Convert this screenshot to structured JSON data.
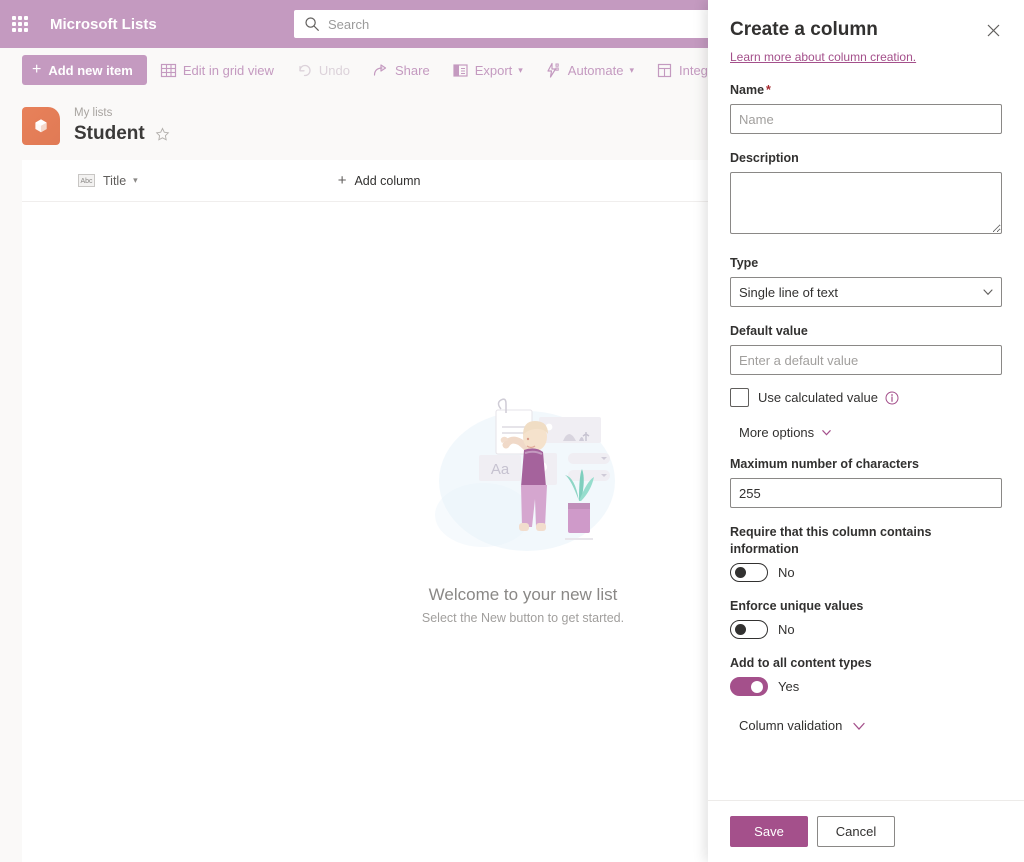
{
  "suite": {
    "waffle_icon": "waffle-grid-icon",
    "app_title": "Microsoft Lists",
    "search": {
      "icon": "search-icon",
      "placeholder": "Search",
      "value": ""
    },
    "bar_color": "#c49ac0"
  },
  "command_bar": {
    "primary": {
      "label": "Add new item",
      "icon": "plus-icon"
    },
    "items": [
      {
        "label": "Edit in grid view",
        "icon": "grid-icon",
        "disabled": false,
        "chevron": false
      },
      {
        "label": "Undo",
        "icon": "undo-icon",
        "disabled": true,
        "chevron": false
      },
      {
        "label": "Share",
        "icon": "share-icon",
        "disabled": false,
        "chevron": false
      },
      {
        "label": "Export",
        "icon": "export-icon",
        "disabled": false,
        "chevron": true
      },
      {
        "label": "Automate",
        "icon": "automate-icon",
        "disabled": false,
        "chevron": true
      },
      {
        "label": "Integ",
        "icon": "integrate-icon",
        "disabled": false,
        "chevron": false
      }
    ]
  },
  "list_header": {
    "logo_icon": "list-cube-icon",
    "logo_color": "#e8815a",
    "breadcrumb": "My lists",
    "title": "Student",
    "favorite_icon": "star-outline-icon"
  },
  "grid": {
    "columns": [
      {
        "label": "Title",
        "icon": "abc-text-icon",
        "chevron": "chevron-down-icon"
      }
    ],
    "add_column_label": "Add column",
    "add_column_icon": "plus-icon"
  },
  "empty_state": {
    "illustration": "welcome-illustration",
    "title": "Welcome to your new list",
    "subtitle": "Select the New button to get started."
  },
  "chat_fab": {
    "icon": "chat-bot-icon"
  },
  "panel": {
    "title": "Create a column",
    "close_icon": "close-icon",
    "learn_more_link": "Learn more about column creation.",
    "accent_color": "#a4508b",
    "fields": {
      "name": {
        "label": "Name",
        "required_mark": "*",
        "placeholder": "Name",
        "value": ""
      },
      "description": {
        "label": "Description",
        "placeholder": "",
        "value": ""
      },
      "type": {
        "label": "Type",
        "selected": "Single line of text",
        "chevron_icon": "chevron-down-icon",
        "options": [
          "Single line of text"
        ]
      },
      "default_value": {
        "label": "Default value",
        "placeholder": "Enter a default value",
        "value": ""
      },
      "use_calculated_value": {
        "label": "Use calculated value",
        "checked": false,
        "info_icon": "info-icon"
      },
      "more_options": {
        "label": "More options",
        "icon": "chevron-down-icon"
      },
      "max_characters": {
        "label": "Maximum number of characters",
        "value": "255"
      },
      "require_information": {
        "label": "Require that this column contains information",
        "value": "No",
        "on": false
      },
      "enforce_unique": {
        "label": "Enforce unique values",
        "value": "No",
        "on": false
      },
      "add_all_content_types": {
        "label": "Add to all content types",
        "value": "Yes",
        "on": true
      },
      "column_validation": {
        "label": "Column validation",
        "icon": "chevron-down-icon"
      }
    },
    "footer": {
      "save_label": "Save",
      "cancel_label": "Cancel"
    }
  }
}
